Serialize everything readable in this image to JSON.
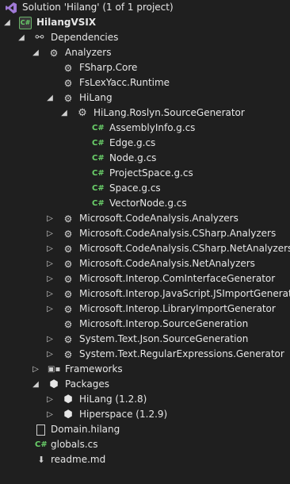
{
  "tree": {
    "solution_label": "Solution 'Hilang' (1 of 1 project)",
    "project_label": "HilangVSIX",
    "dependencies_label": "Dependencies",
    "analyzers_label": "Analyzers",
    "analyzers_items": [
      "FSharp.Core",
      "FsLexYacc.Runtime",
      "HiLang"
    ],
    "generator_label": "HiLang.Roslyn.SourceGenerator",
    "generated_files": [
      "AssemblyInfo.g.cs",
      "Edge.g.cs",
      "Node.g.cs",
      "ProjectSpace.g.cs",
      "Space.g.cs",
      "VectorNode.g.cs"
    ],
    "other_analyzers": [
      "Microsoft.CodeAnalysis.Analyzers",
      "Microsoft.CodeAnalysis.CSharp.Analyzers",
      "Microsoft.CodeAnalysis.CSharp.NetAnalyzers",
      "Microsoft.CodeAnalysis.NetAnalyzers",
      "Microsoft.Interop.ComInterfaceGenerator",
      "Microsoft.Interop.JavaScript.JSImportGenerator",
      "Microsoft.Interop.LibraryImportGenerator",
      "Microsoft.Interop.SourceGeneration",
      "System.Text.Json.SourceGeneration",
      "System.Text.RegularExpressions.Generator"
    ],
    "frameworks_label": "Frameworks",
    "packages_label": "Packages",
    "packages": [
      "HiLang (1.2.8)",
      "Hiperspace (1.2.9)"
    ],
    "files": [
      "Domain.hilang",
      "globals.cs",
      "readme.md"
    ]
  },
  "icons": {
    "solution": "visual-studio-solution-icon",
    "project": "csharp-project-icon",
    "dependencies": "dependencies-icon",
    "analyzer": "analyzer-icon",
    "generator": "source-generator-gear-icon",
    "csharp_file": "csharp-file-icon",
    "frameworks": "frameworks-icon",
    "package": "nuget-package-icon",
    "file": "file-icon",
    "readme": "markdown-file-icon"
  },
  "colors": {
    "background": "#1f1f1f",
    "text": "#e6e6e6",
    "csharp_green": "#6bd26b",
    "solution_purple": "#a07ad6"
  }
}
